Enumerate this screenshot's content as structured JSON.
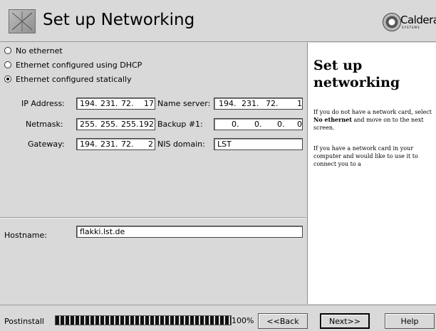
{
  "header": {
    "title": "Set up Networking",
    "logo_text": "Caldera",
    "logo_sub": "SYSTEMS"
  },
  "options": [
    {
      "label": "No ethernet",
      "selected": false
    },
    {
      "label": "Ethernet configured using DHCP",
      "selected": false
    },
    {
      "label": "Ethernet configured statically",
      "selected": true
    }
  ],
  "fields": {
    "ip_label": "IP Address:",
    "ip": [
      "194.",
      "231.",
      "72.",
      "17"
    ],
    "netmask_label": "Netmask:",
    "netmask": [
      "255.",
      "255.",
      "255.",
      "192"
    ],
    "gateway_label": "Gateway:",
    "gateway": [
      "194.",
      "231.",
      "72.",
      "2"
    ],
    "ns_label": "Name server:",
    "ns": [
      "194.",
      "231.",
      "72.",
      "1"
    ],
    "backup_label": "Backup #1:",
    "backup": [
      "0.",
      "0.",
      "0.",
      "0"
    ],
    "nis_label": "NIS domain:",
    "nis": "LST"
  },
  "hostname": {
    "label": "Hostname:",
    "value": "flakki.lst.de"
  },
  "help": {
    "title": "Set up networking",
    "p1_a": "If you do not have a network card, select ",
    "p1_bold": "No ethernet",
    "p1_b": " and move on to the next screen.",
    "p2": "If you have a network card in your computer and would like to use it to connect you to a"
  },
  "footer": {
    "progress_label": "Postinstall",
    "progress_value": 100,
    "progress_text": "100%",
    "back": "<<Back",
    "next": "Next>>",
    "help": "Help"
  }
}
